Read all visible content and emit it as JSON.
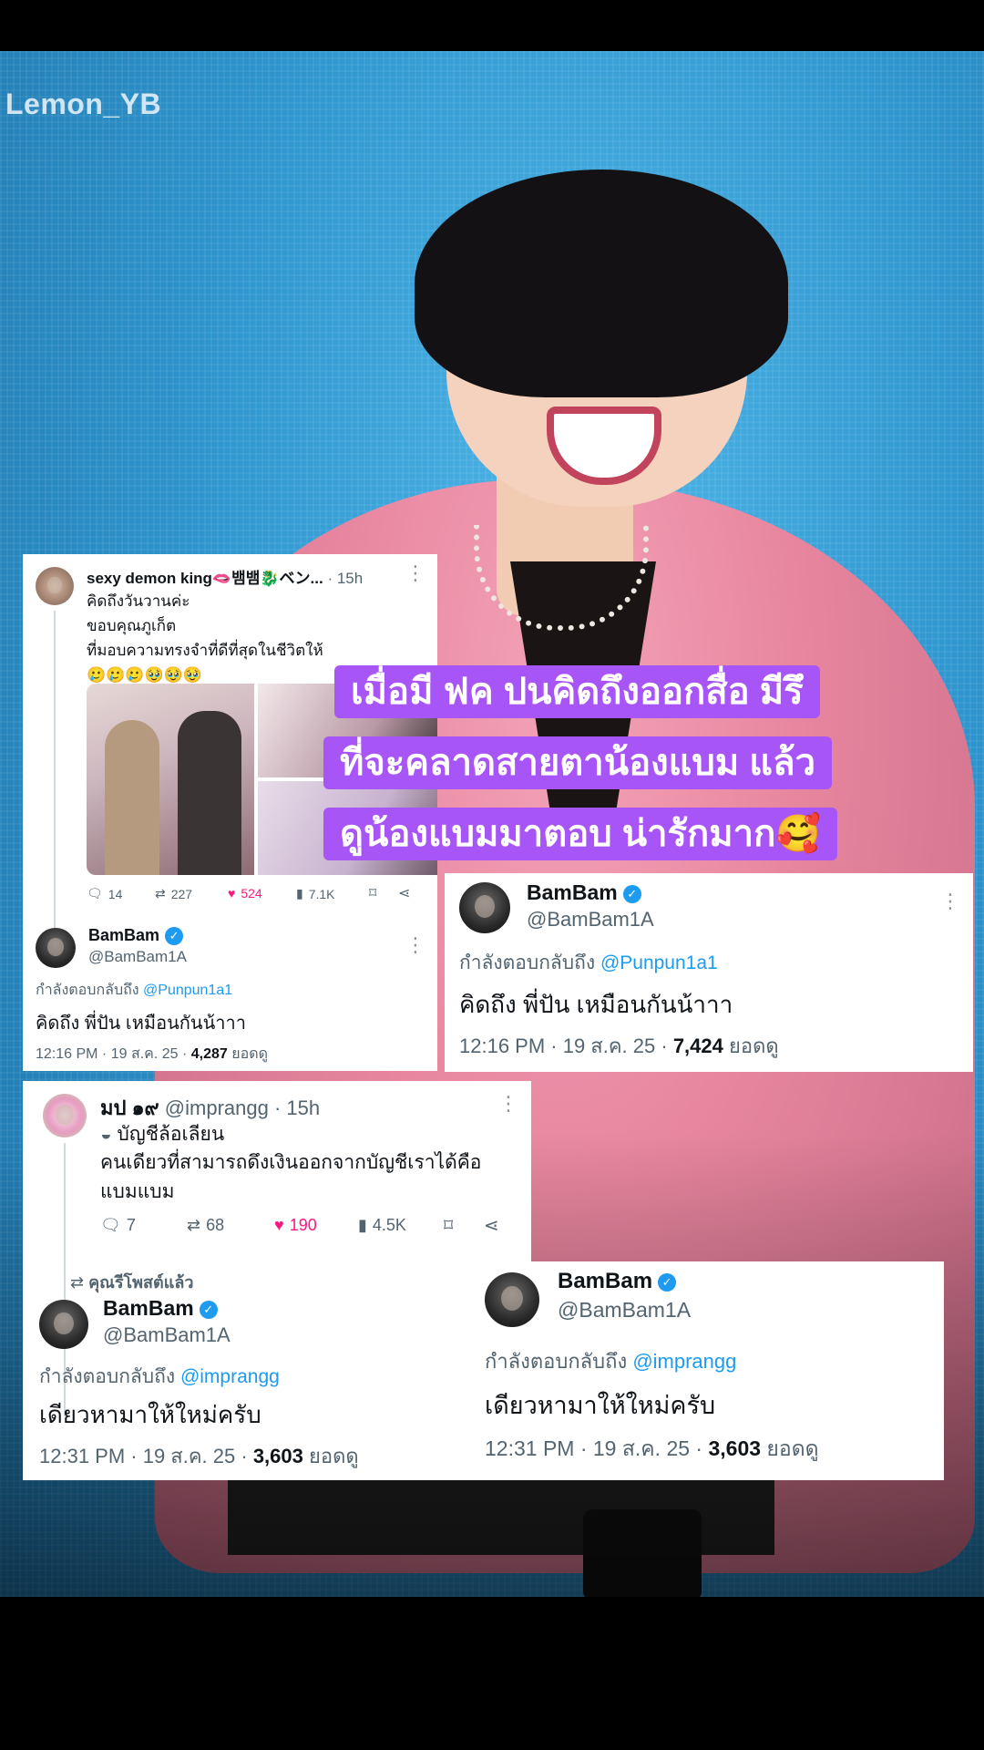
{
  "watermark": "Lemon_YB",
  "caption": {
    "lines": [
      "เมื่อมี ฟค ปนคิดถึงออกสื่อ มีรึ",
      "ที่จะคลาดสายตาน้องแบม แล้ว",
      "ดูน้องแบมมาตอบ น่ารักมาก🥰"
    ]
  },
  "card1": {
    "parent": {
      "name": "sexy demon king🫦뱀뱀🐉ベン...",
      "time": "· 15h",
      "lines": [
        "คิดถึงวันวานค่ะ",
        "ขอบคุณภูเก็ต",
        "ที่มอบความทรงจำที่ดีที่สุดในชีวิตให้",
        "🥲🥲🥲🥹🥹🥹"
      ],
      "stats": {
        "replies": "14",
        "reposts": "227",
        "likes": "524",
        "views": "7.1K"
      }
    },
    "reply": {
      "name": "BamBam",
      "handle": "@BamBam1A",
      "replying_label": "กำลังตอบกลับถึง",
      "replying_to": "@Punpun1a1",
      "text": "คิดถึง พี่ปัน เหมือนกันน้าาา",
      "meta": "12:16 PM · 19 ส.ค. 25 · ",
      "views_num": "4,287",
      "views_label": " ยอดดู"
    }
  },
  "card2": {
    "name": "BamBam",
    "handle": "@BamBam1A",
    "replying_label": "กำลังตอบกลับถึง",
    "replying_to": "@Punpun1a1",
    "text": "คิดถึง พี่ปัน เหมือนกันน้าาา",
    "meta": "12:16 PM · 19 ส.ค. 25 · ",
    "views_num": "7,424",
    "views_label": " ยอดดู"
  },
  "card3": {
    "parent": {
      "name": "มป ๑๙",
      "handle": "@imprangg",
      "time": "· 15h",
      "parody": "บัญชีล้อเลียน",
      "lines": [
        "คนเดียวที่สามารถดึงเงินออกจากบัญชีเราได้คือ",
        "แบมแบม"
      ],
      "stats": {
        "replies": "7",
        "reposts": "68",
        "likes": "190",
        "views": "4.5K"
      }
    },
    "reposted_label": "คุณรีโพสต์แล้ว",
    "reply": {
      "name": "BamBam",
      "handle": "@BamBam1A",
      "replying_label": "กำลังตอบกลับถึง",
      "replying_to": "@imprangg",
      "text": "เดียวหามาให้ใหม่ครับ",
      "meta": "12:31 PM · 19 ส.ค. 25 · ",
      "views_num": "3,603",
      "views_label": " ยอดดู"
    }
  },
  "card4": {
    "name": "BamBam",
    "handle": "@BamBam1A",
    "replying_label": "กำลังตอบกลับถึง",
    "replying_to": "@imprangg",
    "text": "เดียวหามาให้ใหม่ครับ",
    "meta": "12:31 PM · 19 ส.ค. 25 · ",
    "views_num": "3,603",
    "views_label": " ยอดดู"
  },
  "colors": {
    "accent": "#1d9bf0",
    "like": "#f91880",
    "caption_bg": "#a855f7"
  }
}
